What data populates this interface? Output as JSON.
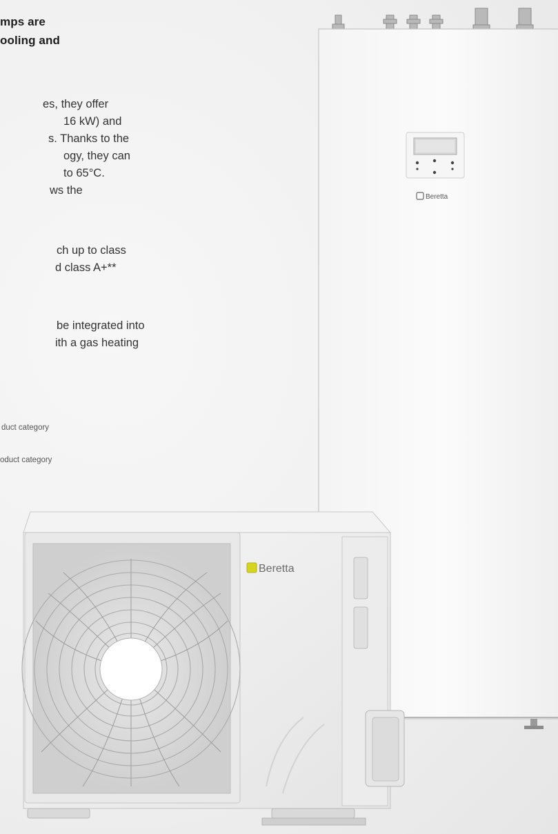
{
  "text": {
    "heading_lines": [
      "mps are",
      "ooling and"
    ],
    "body_lines": [
      "es, they offer",
      "16 kW) and",
      "s. Thanks to the",
      "ogy, they can",
      "to 65°C.",
      "ws the",
      "ch up to class",
      "d class A+**",
      "be integrated into",
      "ith a gas heating"
    ],
    "footnotes": [
      "duct category",
      "oduct category"
    ]
  },
  "product": {
    "indoor_brand": "Beretta",
    "outdoor_brand": "Beretta",
    "logo_color": "#d6d51e"
  }
}
